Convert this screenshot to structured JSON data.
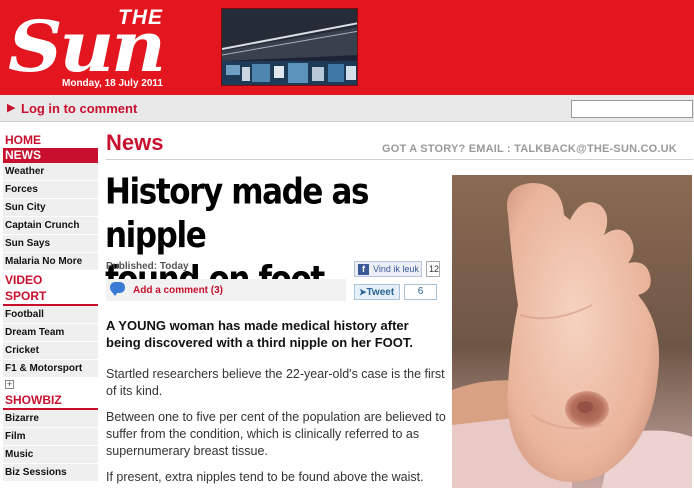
{
  "masthead": {
    "logo_the": "THE",
    "logo_sun": "Sun",
    "date": "Monday, 18 July 2011"
  },
  "loginbar": {
    "login_label": "Log in to comment",
    "arrow_icon": "play-arrow-icon",
    "search_value": ""
  },
  "nav": {
    "home": "HOME",
    "news": "NEWS",
    "news_items": [
      "Weather",
      "Forces",
      "Sun City",
      "Captain Crunch",
      "Sun Says",
      "Malaria No More"
    ],
    "video": "VIDEO",
    "sport": "SPORT",
    "sport_items": [
      "Football",
      "Dream Team",
      "Cricket",
      "F1 & Motorsport"
    ],
    "expand_icon": "plus-icon",
    "showbiz": "SHOWBIZ",
    "showbiz_items": [
      "Bizarre",
      "Film",
      "Music",
      "Biz Sessions"
    ]
  },
  "article": {
    "section": "News",
    "story_tip": "GOT A STORY? EMAIL : TALKBACK@THE-SUN.CO.UK",
    "headline_line1": "History made as nipple",
    "headline_line2": "found on foot",
    "published": "Published: Today",
    "comment_label": "Add a comment (3)",
    "lede": "A YOUNG woman has made medical history after being discovered with a third nipple on her FOOT.",
    "p1": "Startled researchers believe the 22-year-old's case is the first of its kind.",
    "p2": "Between one to five per cent of the population are believed to suffer from the condition, which is clinically referred to as supernumerary breast tissue.",
    "p3": "If present, extra nipples tend to be found above the waist."
  },
  "social": {
    "fb_label": "Vind ik leuk",
    "fb_count": "12",
    "tweet_label": "Tweet",
    "tweet_count": "6"
  },
  "colors": {
    "brand_red": "#e3161f",
    "link_red": "#c8102e"
  }
}
